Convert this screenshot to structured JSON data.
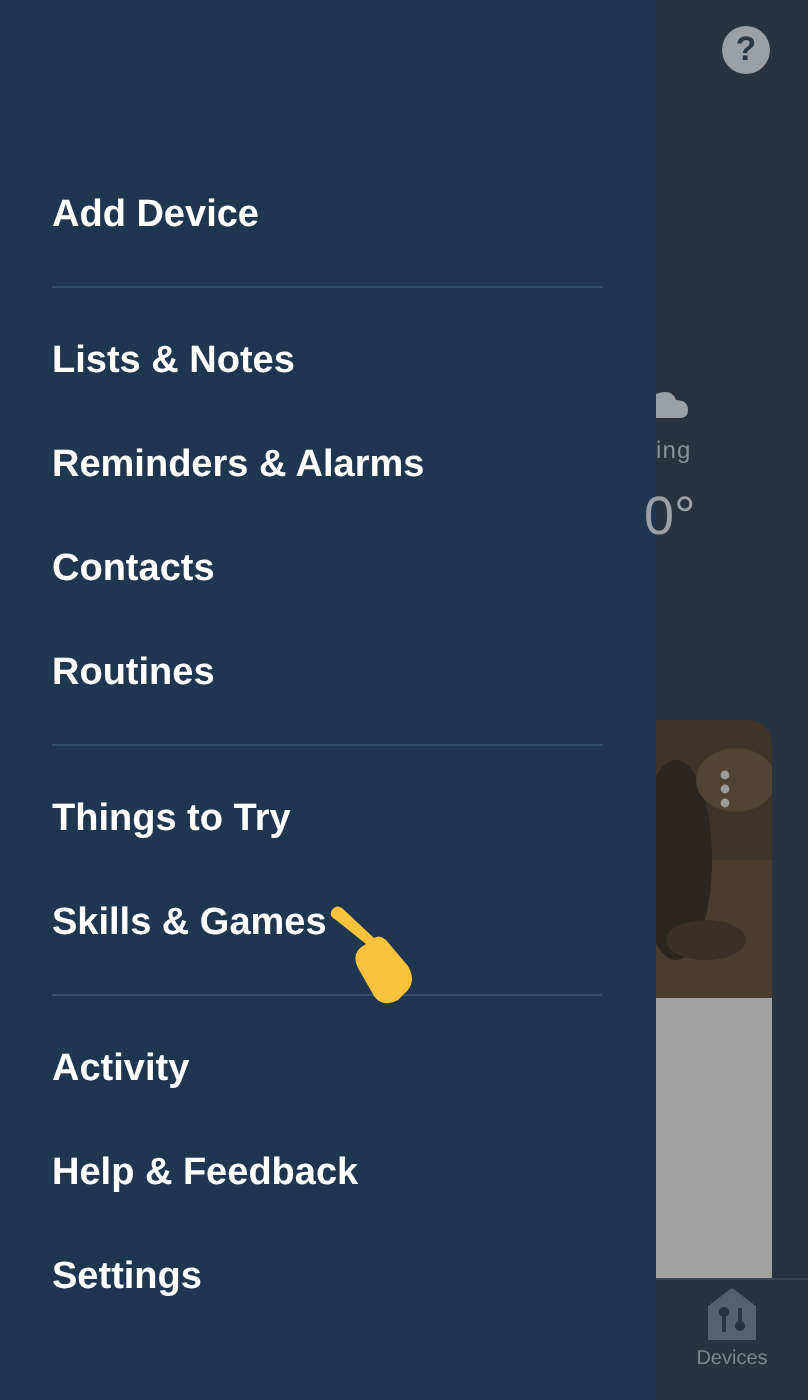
{
  "menu": {
    "sections": [
      [
        {
          "label": "Add Device"
        }
      ],
      [
        {
          "label": "Lists & Notes"
        },
        {
          "label": "Reminders & Alarms"
        },
        {
          "label": "Contacts"
        },
        {
          "label": "Routines"
        }
      ],
      [
        {
          "label": "Things to Try"
        },
        {
          "label": "Skills & Games"
        }
      ],
      [
        {
          "label": "Activity"
        },
        {
          "label": "Help & Feedback"
        },
        {
          "label": "Settings"
        }
      ]
    ]
  },
  "background": {
    "help": "?",
    "weather_label": "ing",
    "temperature": "0°",
    "nav_item": {
      "label": "Devices"
    }
  }
}
